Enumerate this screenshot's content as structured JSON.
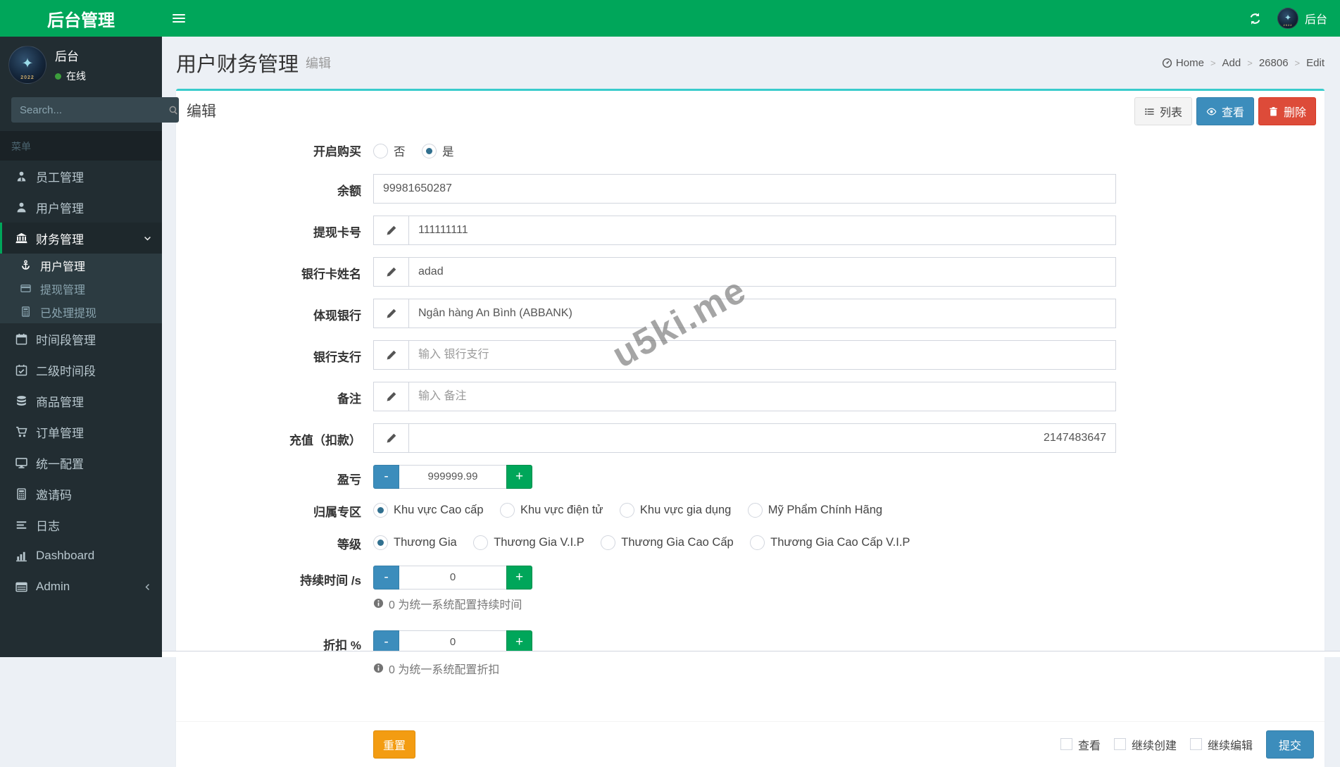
{
  "brand": "后台管理",
  "navbar": {
    "user": "后台"
  },
  "sidebar": {
    "user_name": "后台",
    "user_status": "在线",
    "search_placeholder": "Search...",
    "menu_header": "菜单",
    "items": [
      {
        "label": "员工管理"
      },
      {
        "label": "用户管理"
      },
      {
        "label": "财务管理"
      },
      {
        "label": "用户管理"
      },
      {
        "label": "提现管理"
      },
      {
        "label": "已处理提现"
      },
      {
        "label": "时间段管理"
      },
      {
        "label": "二级时间段"
      },
      {
        "label": "商品管理"
      },
      {
        "label": "订单管理"
      },
      {
        "label": "统一配置"
      },
      {
        "label": "邀请码"
      },
      {
        "label": "日志"
      },
      {
        "label": "Dashboard"
      },
      {
        "label": "Admin"
      }
    ]
  },
  "page": {
    "title": "用户财务管理",
    "subtitle": "编辑"
  },
  "breadcrumb": {
    "items": [
      "Home",
      "Add",
      "26806",
      "Edit"
    ]
  },
  "panel": {
    "title": "编辑",
    "list_btn": "列表",
    "view_btn": "查看",
    "delete_btn": "删除"
  },
  "form": {
    "purchase": {
      "label": "开启购买",
      "no": "否",
      "yes": "是",
      "selected": "是"
    },
    "balance": {
      "label": "余额",
      "value": "99981650287"
    },
    "card_no": {
      "label": "提现卡号",
      "value": "111111111"
    },
    "card_name": {
      "label": "银行卡姓名",
      "value": "adad"
    },
    "bank": {
      "label": "体现银行",
      "value": "Ngân hàng An Bình (ABBANK)"
    },
    "branch": {
      "label": "银行支行",
      "placeholder": "输入 银行支行"
    },
    "remark": {
      "label": "备注",
      "placeholder": "输入 备注"
    },
    "recharge": {
      "label": "充值（扣款）",
      "value": "2147483647"
    },
    "profit": {
      "label": "盈亏",
      "value": "999999.99"
    },
    "zone": {
      "label": "归属专区",
      "options": [
        "Khu vực Cao cấp",
        "Khu vực điện tử",
        "Khu vực gia dụng",
        "Mỹ Phẩm Chính Hãng"
      ],
      "selected": "Khu vực Cao cấp"
    },
    "level": {
      "label": "等级",
      "options": [
        "Thương Gia",
        "Thương Gia V.I.P",
        "Thương Gia Cao Cấp",
        "Thương Gia Cao Cấp V.I.P"
      ],
      "selected": "Thương Gia"
    },
    "duration": {
      "label": "持续时间 /s",
      "value": "0",
      "hint": "0 为统一系统配置持续时间"
    },
    "discount": {
      "label": "折扣 %",
      "value": "0",
      "hint": "0 为统一系统配置折扣"
    },
    "stepper": {
      "minus": "-",
      "plus": "+"
    }
  },
  "footer": {
    "reset": "重置",
    "checks": [
      "查看",
      "继续创建",
      "继续编辑"
    ],
    "submit": "提交"
  },
  "watermark": "u5ki.me",
  "colors": {
    "green": "#00a65a",
    "teal": "#39cccc",
    "blue": "#3c8dbc",
    "red": "#dd4b39",
    "orange": "#f39c12",
    "sidebar": "#222d32"
  }
}
